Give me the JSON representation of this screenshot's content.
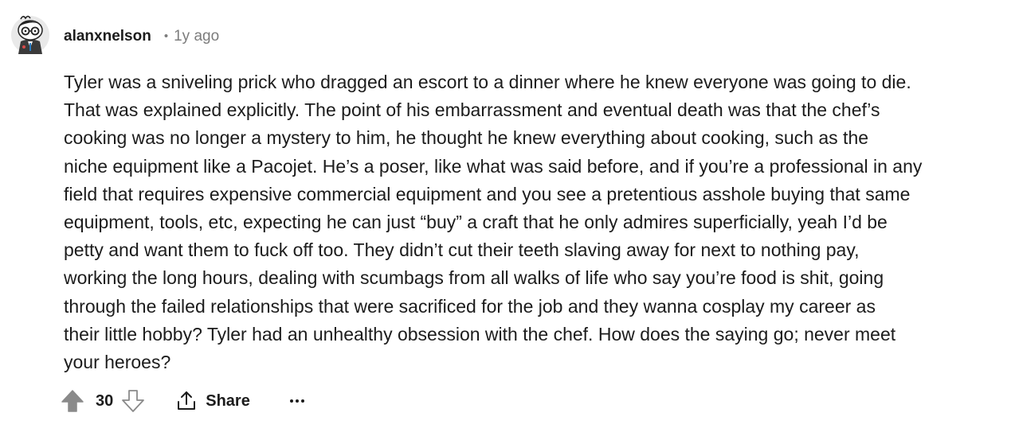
{
  "comment": {
    "author": "alanxnelson",
    "separator": "•",
    "age": "1y ago",
    "body_lines": [
      "Tyler was a sniveling prick who dragged an escort to a dinner where he knew everyone was going to die.",
      "That was explained explicitly. The point of his embarrassment and eventual death was that the chef’s",
      "cooking was no longer a mystery to him, he thought he knew everything about cooking, such as the",
      "niche equipment like a Pacojet. He’s a poser, like what was said before, and if you’re a professional in any",
      "field that requires expensive commercial equipment and you see a pretentious asshole buying that same",
      "equipment, tools, etc, expecting he can just “buy” a craft that he only admires superficially, yeah I’d be",
      "petty and want them to fuck off too. They didn’t cut their teeth slaving away for next to nothing pay,",
      "working the long hours, dealing with scumbags from all walks of life who say you’re food is shit, going",
      "through the failed relationships that were sacrificed for the job and they wanna cosplay my career as",
      "their little hobby? Tyler had an unhealthy obsession with the chef. How does the saying go; never meet",
      "your heroes?"
    ],
    "score": "30",
    "share_label": "Share",
    "more_label": "•••"
  },
  "colors": {
    "text": "#1c1c1c",
    "muted": "#7c7c7c",
    "upvote_fill": "#8a8a8a"
  },
  "icons": {
    "avatar": "snoo-avatar-glasses",
    "upvote": "upvote-arrow-icon",
    "downvote": "downvote-arrow-icon",
    "share": "share-icon",
    "more": "ellipsis-icon"
  }
}
